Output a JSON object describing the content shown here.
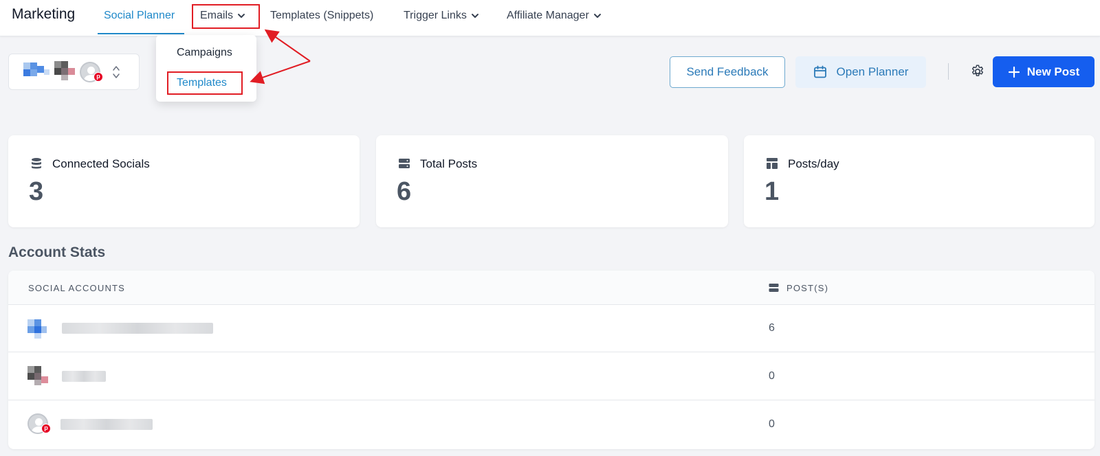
{
  "topnav": {
    "brand": "Marketing",
    "items": [
      {
        "label": "Social Planner",
        "active": true
      },
      {
        "label": "Emails",
        "dropdown": true
      },
      {
        "label": "Templates (Snippets)"
      },
      {
        "label": "Trigger Links",
        "dropdown": true
      },
      {
        "label": "Affiliate Manager",
        "dropdown": true
      }
    ]
  },
  "emails_dropdown": {
    "items": [
      {
        "label": "Campaigns"
      },
      {
        "label": "Templates",
        "selected": true
      }
    ]
  },
  "toolbar": {
    "send_feedback": "Send Feedback",
    "open_planner": "Open Planner",
    "new_post": "New Post"
  },
  "stats": [
    {
      "label": "Connected Socials",
      "value": "3",
      "icon": "database-icon"
    },
    {
      "label": "Total Posts",
      "value": "6",
      "icon": "server-icon"
    },
    {
      "label": "Posts/day",
      "value": "1",
      "icon": "layout-icon"
    }
  ],
  "account_stats": {
    "title": "Account Stats",
    "columns": {
      "accounts": "SOCIAL ACCOUNTS",
      "posts": "POST(S)"
    },
    "rows": [
      {
        "posts": "6",
        "avatar": "blurred-blue"
      },
      {
        "posts": "0",
        "avatar": "blurred-dark"
      },
      {
        "posts": "0",
        "avatar": "pinterest-default"
      }
    ]
  },
  "colors": {
    "accent": "#1e88c9",
    "primary_button": "#155eef",
    "annotation": "#e11d24",
    "pinterest": "#e60023"
  }
}
